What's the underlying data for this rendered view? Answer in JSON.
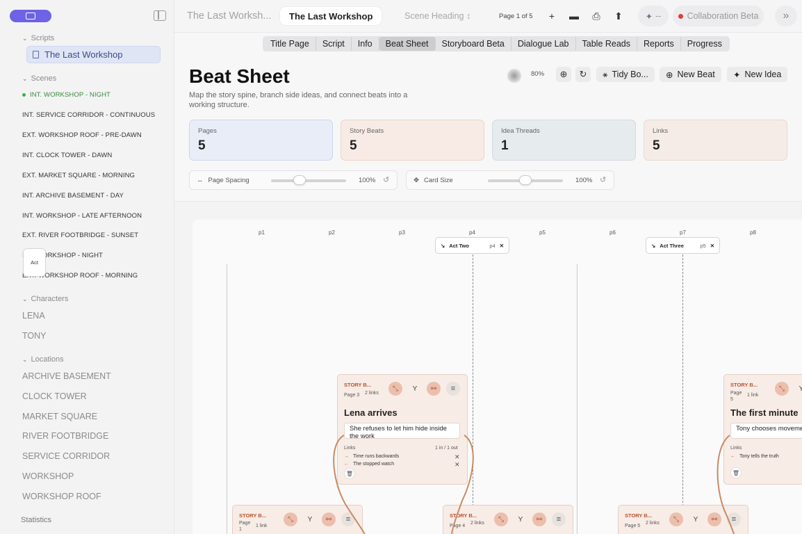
{
  "sidebar": {
    "scripts_label": "Scripts",
    "script_item": "The Last Workshop",
    "scenes_label": "Scenes",
    "scenes": [
      "INT. WORKSHOP - NIGHT",
      "INT. SERVICE CORRIDOR - CONTINUOUS",
      "EXT. WORKSHOP ROOF - PRE-DAWN",
      "INT. CLOCK TOWER - DAWN",
      "EXT. MARKET SQUARE - MORNING",
      "INT. ARCHIVE BASEMENT - DAY",
      "INT. WORKSHOP - LATE AFTERNOON",
      "EXT. RIVER FOOTBRIDGE - SUNSET",
      "INT. WORKSHOP - NIGHT",
      "EXT. WORKSHOP ROOF - MORNING"
    ],
    "characters_label": "Characters",
    "characters": [
      "LENA",
      "TONY"
    ],
    "locations_label": "Locations",
    "locations": [
      "ARCHIVE BASEMENT",
      "CLOCK TOWER",
      "MARKET SQUARE",
      "RIVER FOOTBRIDGE",
      "SERVICE CORRIDOR",
      "WORKSHOP",
      "WORKSHOP ROOF"
    ],
    "statistics_label": "Statistics"
  },
  "topbar": {
    "title_dim": "The Last Worksh...",
    "title_tab": "The Last Workshop",
    "scene_heading": "Scene Heading ↕",
    "page_indicator": "Page 1 of 5",
    "ai_label": "--",
    "collab_label": "Collaboration Beta"
  },
  "tabs": [
    "Title Page",
    "Script",
    "Info",
    "Beat Sheet",
    "Storyboard Beta",
    "Dialogue Lab",
    "Table Reads",
    "Reports",
    "Progress"
  ],
  "selected_tab": "Beat Sheet",
  "header": {
    "title": "Beat Sheet",
    "description": "Map the story spine, branch side ideas, and connect beats into a working structure.",
    "zoom": "80%",
    "tidy_label": "Tidy Bo...",
    "new_beat_label": "New Beat",
    "new_idea_label": "New Idea"
  },
  "stats": [
    {
      "label": "Pages",
      "value": "5",
      "bg": "#e8edf8",
      "border": "#cdd6ee"
    },
    {
      "label": "Story Beats",
      "value": "5",
      "bg": "#f8ebe5",
      "border": "#ecd3c6"
    },
    {
      "label": "Idea Threads",
      "value": "1",
      "bg": "#e6ebee",
      "border": "#d3dadf"
    },
    {
      "label": "Links",
      "value": "5",
      "bg": "#f5ece8",
      "border": "#e8d9d1"
    }
  ],
  "controls": {
    "page_spacing_label": "Page Spacing",
    "page_spacing_value": "100%",
    "page_spacing_level": 0.35,
    "card_size_label": "Card Size",
    "card_size_value": "100%",
    "card_size_level": 0.5
  },
  "board": {
    "pages": [
      "p1",
      "p2",
      "p3",
      "p4",
      "p5",
      "p6",
      "p7",
      "p8"
    ],
    "act_label": "Act",
    "act_two": {
      "label": "Act Two",
      "page": "p4"
    },
    "act_three": {
      "label": "Act Three",
      "page": "p5"
    }
  },
  "beats": {
    "lena": {
      "tag": "STORY B...",
      "page": "Page 3",
      "links": "2 links",
      "title": "Lena arrives",
      "note": "She refuses to let him hide inside the work",
      "links_label": "Links",
      "links_count": "1 in / 1 out",
      "link_rows": [
        "Time runs backwards",
        "The stopped watch"
      ]
    },
    "first_minute": {
      "tag": "STORY B...",
      "page": "Page 5",
      "links": "1 link",
      "title": "The first minute",
      "note": "Tony chooses moveme chooses to stay",
      "links_label": "Links",
      "link_rows": [
        "Tony tells the truth"
      ]
    },
    "bottom": [
      {
        "tag": "STORY B...",
        "page": "Page 1",
        "links": "1 link"
      },
      {
        "tag": "STORY B...",
        "page": "Page 4",
        "links": "2 links"
      },
      {
        "tag": "STORY B...",
        "page": "Page 5",
        "links": "2 links"
      }
    ]
  },
  "colors": {
    "accent": "#6c63e6",
    "beat_accent": "#b8532e",
    "curve": "#c98a63",
    "active_scene": "#38b24a",
    "collab_dot": "#e23b3b"
  }
}
